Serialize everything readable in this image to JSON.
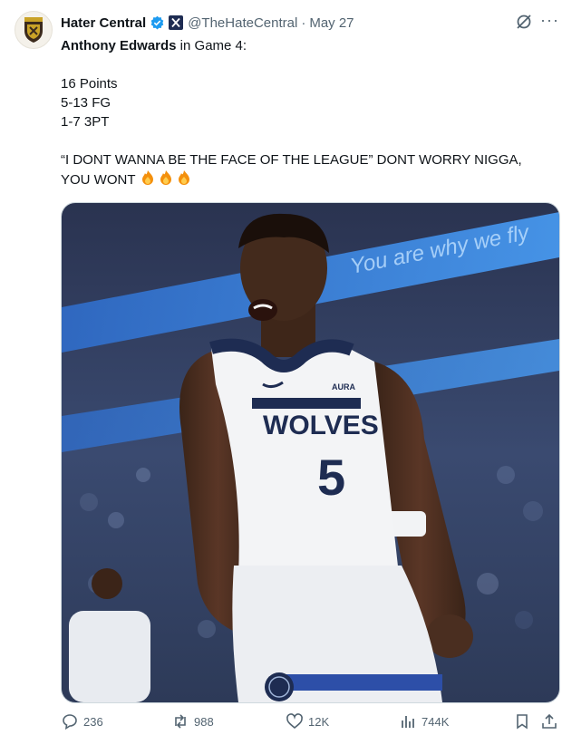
{
  "author": {
    "name": "Hater Central",
    "handle": "@TheHateCentral",
    "date": "May 27"
  },
  "post": {
    "line1_player": "Anthony Edwards",
    "line1_rest": " in Game 4:",
    "stats": [
      "16 Points",
      "5-13 FG",
      "1-7 3PT"
    ],
    "quote_line1": "“I DONT WANNA BE THE FACE OF THE LEAGUE” DONT WORRY NIGGA,",
    "quote_line2": "YOU WONT"
  },
  "media": {
    "arena_banner": "You are why we fly",
    "jersey_brand": "AURA",
    "jersey_team": "WOLVES",
    "jersey_number": "5"
  },
  "actions": {
    "replies": "236",
    "reposts": "988",
    "likes": "12K",
    "views": "744K"
  },
  "colors": {
    "verified": "#1d9bf0",
    "muted": "#536471",
    "navy": "#1e2c52"
  },
  "icons": [
    "grok-icon",
    "more-icon",
    "reply-icon",
    "repost-icon",
    "like-icon",
    "views-icon",
    "bookmark-icon",
    "share-icon",
    "fire-icon"
  ]
}
